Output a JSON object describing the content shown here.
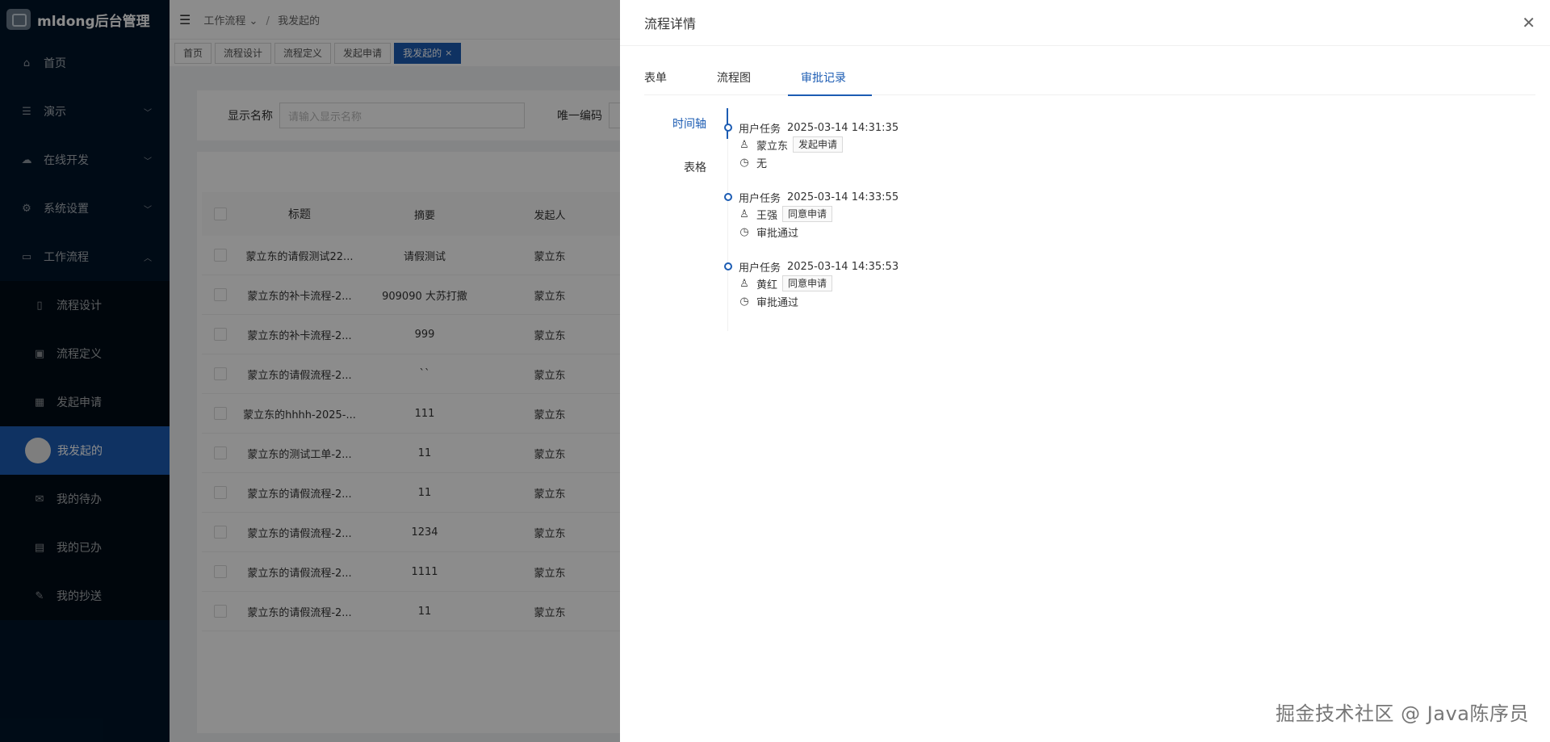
{
  "app": {
    "title": "mldong后台管理"
  },
  "sidebar": {
    "items": [
      {
        "label": "首页",
        "icon": "home-icon",
        "glyph": "⌂"
      },
      {
        "label": "演示",
        "icon": "list-icon",
        "glyph": "☰",
        "arrow": "﹀"
      },
      {
        "label": "在线开发",
        "icon": "cloud-icon",
        "glyph": "☁",
        "arrow": "﹀"
      },
      {
        "label": "系统设置",
        "icon": "gear-icon",
        "glyph": "⚙",
        "arrow": "﹀"
      },
      {
        "label": "工作流程",
        "icon": "laptop-icon",
        "glyph": "▭",
        "arrow": "︿"
      }
    ],
    "subitems": [
      {
        "label": "流程设计",
        "icon": "file-icon",
        "glyph": "▯"
      },
      {
        "label": "流程定义",
        "icon": "image-icon",
        "glyph": "▣"
      },
      {
        "label": "发起申请",
        "icon": "grid-icon",
        "glyph": "▦"
      },
      {
        "label": "我发起的",
        "icon": "avatar-icon",
        "glyph": ""
      },
      {
        "label": "我的待办",
        "icon": "mail-icon",
        "glyph": "✉"
      },
      {
        "label": "我的已办",
        "icon": "book-icon",
        "glyph": "▤"
      },
      {
        "label": "我的抄送",
        "icon": "edit-icon",
        "glyph": "✎"
      }
    ]
  },
  "header": {
    "fold_glyph": "☰",
    "breadcrumb": [
      "工作流程",
      "我发起的"
    ],
    "crumb_arrow": "⌄",
    "crumb_sep": "/"
  },
  "tabs": [
    "首页",
    "流程设计",
    "流程定义",
    "发起申请",
    "我发起的"
  ],
  "tab_close": "×",
  "search": {
    "label1": "显示名称",
    "placeholder1": "请输入显示名称",
    "label2": "唯一编码"
  },
  "table": {
    "headers": {
      "title": "标题",
      "summary": "摘要",
      "initiator": "发起人"
    },
    "rows": [
      {
        "title": "蒙立东的请假测试22...",
        "summary": "请假测试",
        "initiator": "蒙立东"
      },
      {
        "title": "蒙立东的补卡流程-2...",
        "summary": "909090 大苏打撒",
        "initiator": "蒙立东"
      },
      {
        "title": "蒙立东的补卡流程-2...",
        "summary": "999",
        "initiator": "蒙立东"
      },
      {
        "title": "蒙立东的请假流程-2...",
        "summary": "``",
        "initiator": "蒙立东"
      },
      {
        "title": "蒙立东的hhhh-2025-...",
        "summary": "111",
        "initiator": "蒙立东"
      },
      {
        "title": "蒙立东的测试工单-2...",
        "summary": "11",
        "initiator": "蒙立东"
      },
      {
        "title": "蒙立东的请假流程-2...",
        "summary": "11",
        "initiator": "蒙立东"
      },
      {
        "title": "蒙立东的请假流程-2...",
        "summary": "1234",
        "initiator": "蒙立东"
      },
      {
        "title": "蒙立东的请假流程-2...",
        "summary": "1111",
        "initiator": "蒙立东"
      },
      {
        "title": "蒙立东的请假流程-2...",
        "summary": "11",
        "initiator": "蒙立东"
      }
    ]
  },
  "drawer": {
    "title": "流程详情",
    "close_glyph": "✕",
    "tabs": [
      "表单",
      "流程图",
      "审批记录"
    ],
    "active_tab": "审批记录",
    "side_tabs": [
      "时间轴",
      "表格"
    ],
    "active_side_tab": "时间轴",
    "timeline": [
      {
        "task": "用户任务",
        "time": "2025-03-14 14:31:35",
        "user": "蒙立东",
        "action": "发起申请",
        "comment": "无"
      },
      {
        "task": "用户任务",
        "time": "2025-03-14 14:33:55",
        "user": "王强",
        "action": "同意申请",
        "comment": "审批通过"
      },
      {
        "task": "用户任务",
        "time": "2025-03-14 14:35:53",
        "user": "黄红",
        "action": "同意申请",
        "comment": "审批通过"
      }
    ],
    "user_glyph": "♙",
    "comment_glyph": "◷"
  },
  "watermark": "掘金技术社区 @ Java陈序员",
  "colors": {
    "primary": "#1c5cb3",
    "sidebar_bg": "#001529"
  }
}
